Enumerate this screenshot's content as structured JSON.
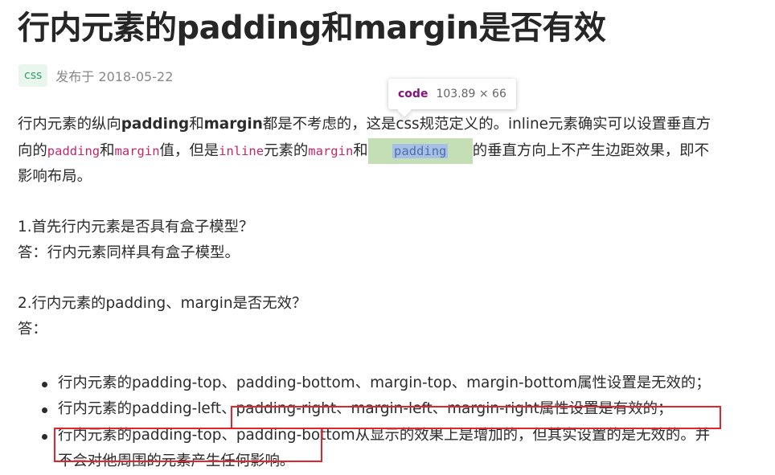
{
  "title": "行内元素的padding和margin是否有效",
  "meta": {
    "tag": "css",
    "published": "发布于 2018-05-22"
  },
  "tooltip": {
    "tag": "code",
    "size": "103.89 × 66"
  },
  "intro": {
    "t1": "行内元素的纵向",
    "b1": "padding",
    "t2": "和",
    "b2": "margin",
    "t3": "都是不考虑的，这是css规范定义的。inline元素确实可以设置垂直方",
    "t4": "向的",
    "c1": "padding",
    "t5": "和",
    "c2": "margin",
    "t6": "值，但是",
    "c3": "inline",
    "t7": "元素的",
    "c4": "margin",
    "t8": "和",
    "c5": "padding",
    "t9": "的垂直方向上不产生边距效果，即不",
    "t10": "影响布局。"
  },
  "q1": {
    "question": "1.首先行内元素是否具有盒子模型？",
    "answer": "答：行内元素同样具有盒子模型。"
  },
  "q2": {
    "question": "2.行内元素的padding、margin是否无效？",
    "answer": "答："
  },
  "list": {
    "item1": "行内元素的padding-top、padding-bottom、margin-top、margin-bottom属性设置是无效的；",
    "item2": "行内元素的padding-left、padding-right、margin-left、margin-right属性设置是有效的；",
    "item3_line1": "行内元素的padding-top、padding-bottom从显示的效果上是增加的，但其实设置的是无效的。并",
    "item3_line2": "不会对他周围的元素产生任何影响。"
  },
  "colors": {
    "code_text": "#c7256d",
    "tag_bg": "#e9f6ee",
    "tag_text": "#3a9b66",
    "highlight_box": "#e0262c",
    "inspect_overlay": "#c4dfb6"
  }
}
